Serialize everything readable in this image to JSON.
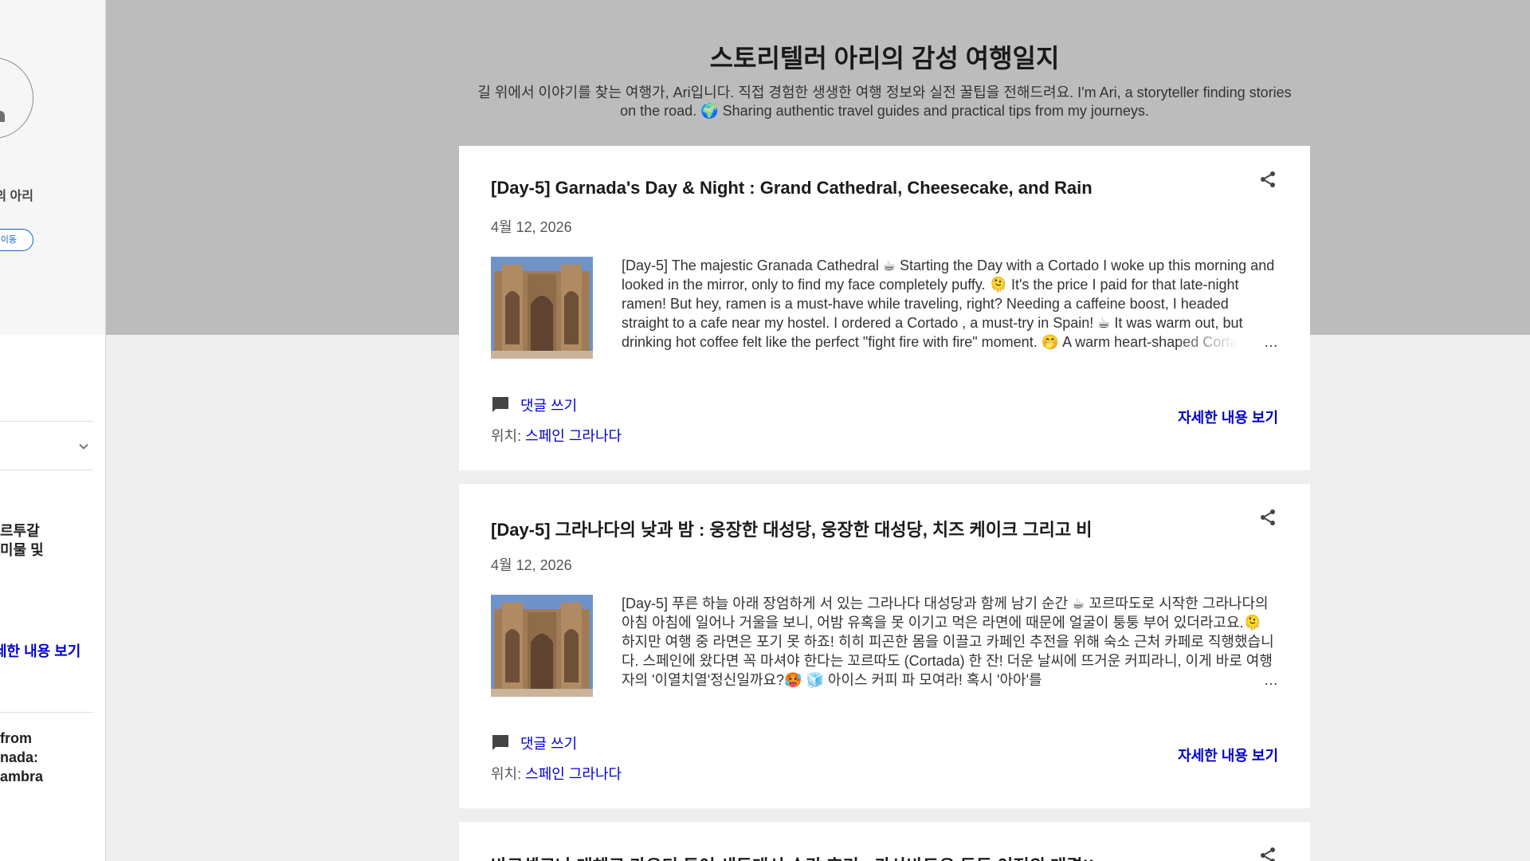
{
  "blog": {
    "title": "스토리텔러 아리의 감성 여행일지",
    "description": "길 위에서 이야기를 찾는 여행가, Ari입니다. 직접 경험한 생생한 여행 정보와 실전 꿀팁을 전해드려요. I'm Ari, a storyteller finding stories on the road. 🌍 Sharing authentic travel guides and practical tips from my journeys."
  },
  "sidebar": {
    "name": "의 아리",
    "profile_button": "이동",
    "posts": [
      {
        "title": "르투갈\n미물 및"
      },
      {
        "title": "from\nnada:\nambra"
      }
    ],
    "read_more": "세한 내용 보기"
  },
  "posts": [
    {
      "title": "[Day-5] Garnada's Day & Night : Grand Cathedral, Cheesecake, and Rain",
      "date": "4월 12, 2026",
      "snippet": "  [Day-5] The majestic Granada Cathedral ☕ Starting the Day with a Cortado I woke up this morning and looked in the mirror, only to find my face completely puffy. 🫠 It's the price I paid for that late-night ramen! But hey, ramen is a must-have while traveling, right? Needing a caffeine boost, I headed straight to a cafe near my hostel. I ordered a Cortado , a must-try in Spain! ☕ It was warm out, but drinking hot coffee felt like the perfect \"fight fire with fire\" moment. 🤭 A warm heart-shaped Cortado latte",
      "ellipsis": "…",
      "comment": "댓글 쓰기",
      "location_label": "위치:",
      "location": "스페인 그라나다",
      "read_more": "자세한 내용 보기"
    },
    {
      "title": "[Day-5] 그라나다의 낮과 밤 : 웅장한 대성당, 웅장한 대성당, 치즈 케이크 그리고 비",
      "date": "4월 12, 2026",
      "snippet": "[Day-5] 푸른 하늘 아래 장엄하게 서 있는 그라나다 대성당과 함께 남기 순간 ☕ 꼬르따도로 시작한 그라나다의 아침 아침에 일어나 거울을 보니, 어밤 유혹을 못 이기고 먹은 라면에 때문에 얼굴이 퉁퉁 부어 있더라고요.🫠 하지만 여행 중 라면은 포기 못 하죠! 히히 피곤한 몸을 이끌고 카페인 추전을 위해 숙소 근처 카페로 직행했습니다. 스페인에 왔다면 꼭 마셔야 한다는 꼬르따도 (Cortada)  한 잔! 더운 날씨에 뜨거운 커피라니, 이게 바로 여행자의  '이열치열'정신일까요?🥵 🧊 아이스 커피 파 모여라! 혹시 '아아'를",
      "ellipsis": "…",
      "comment": "댓글 쓰기",
      "location_label": "위치:",
      "location": "스페인 그라나다",
      "read_more": "자세한 내용 보기"
    },
    {
      "title": "바르셀로나 대체로 가우디 투어 새등대시 순간 후기 : 카사바트요 등등 이전의 대결!!"
    }
  ],
  "icons": {
    "share": "share-icon",
    "comment": "comment-icon",
    "chevron": "chevron-down-icon"
  },
  "colors": {
    "header_bg": "#bcbcbc",
    "link": "#0000cc",
    "page_bg": "#eeeeee"
  }
}
